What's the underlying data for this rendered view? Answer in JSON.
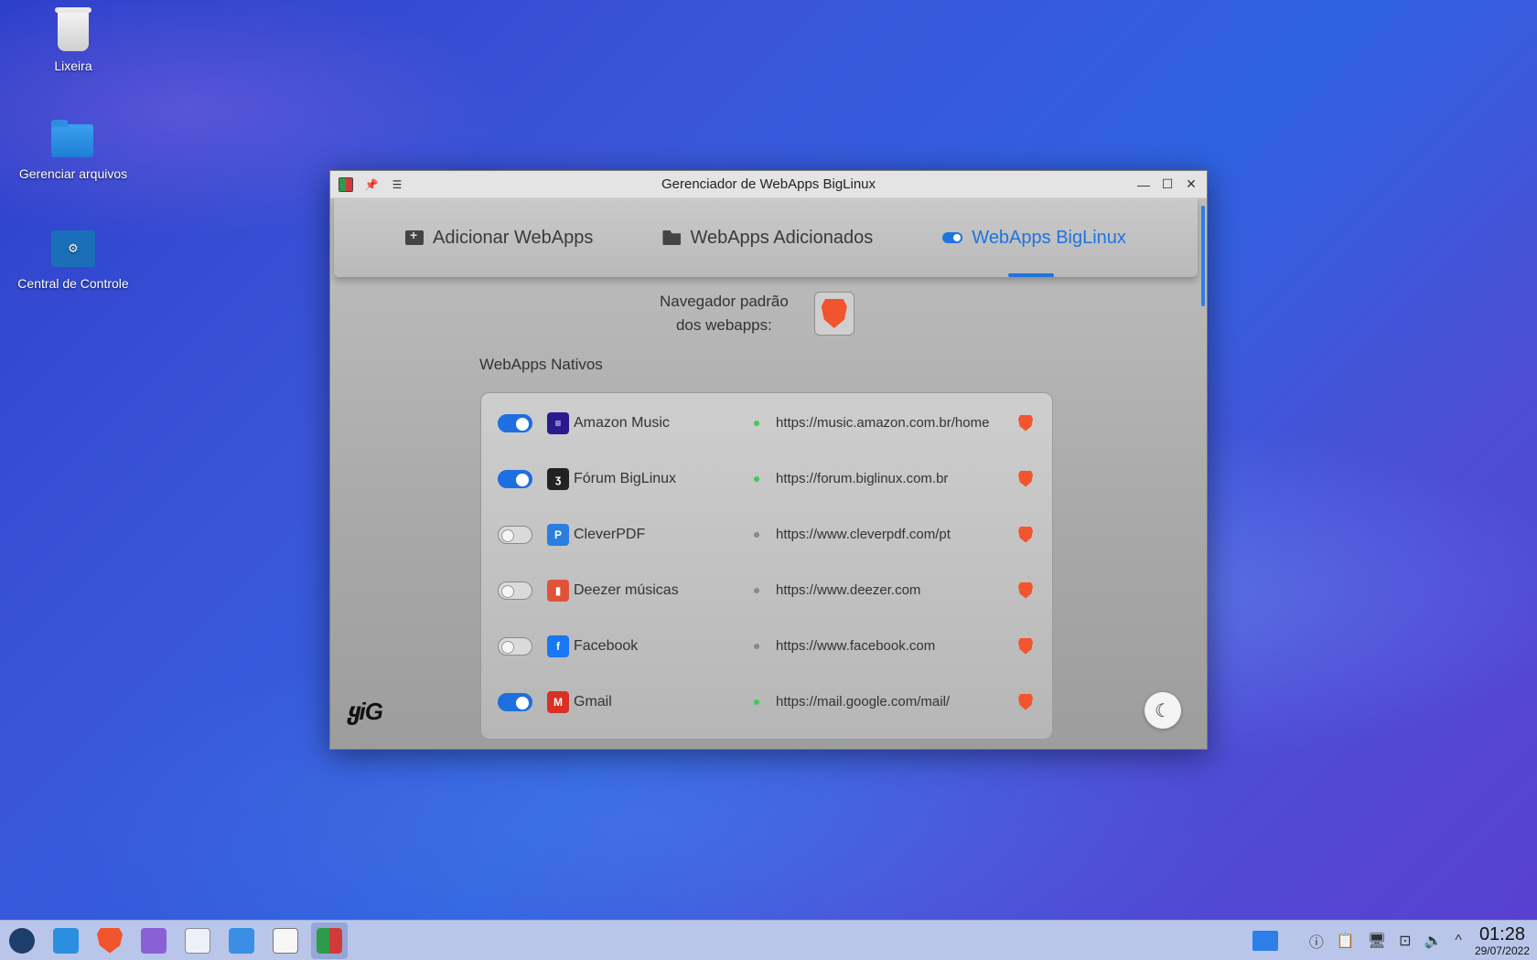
{
  "desktop": {
    "icons": [
      {
        "label": "Lixeira",
        "icon": "trash-icon"
      },
      {
        "label": "Gerenciar arquivos",
        "icon": "folder-icon"
      },
      {
        "label": "Central de Controle",
        "icon": "control-center-icon"
      }
    ]
  },
  "window": {
    "title": "Gerenciador de WebApps BigLinux",
    "tabs": [
      {
        "label": "Adicionar WebApps",
        "icon": "folder-plus-icon",
        "active": false
      },
      {
        "label": "WebApps Adicionados",
        "icon": "folder-open-icon",
        "active": false
      },
      {
        "label": "WebApps BigLinux",
        "icon": "toggle-icon",
        "active": true
      }
    ],
    "browser_label_line1": "Navegador padrão",
    "browser_label_line2": "dos webapps:",
    "section_title": "WebApps Nativos",
    "logo_text": "ყiG",
    "theme_icon": "moon-icon",
    "colors": {
      "accent": "#1e74e0",
      "status_on": "#3fc95a",
      "brave": "#f2542d"
    },
    "webapps": [
      {
        "name": "Amazon Music",
        "url": "https://music.amazon.com.br/home",
        "enabled": true,
        "icon_color": "#2a1a8e",
        "icon_text": "≡"
      },
      {
        "name": "Fórum BigLinux",
        "url": "https://forum.biglinux.com.br",
        "enabled": true,
        "icon_color": "#222222",
        "icon_text": "ʒ"
      },
      {
        "name": "CleverPDF",
        "url": "https://www.cleverpdf.com/pt",
        "enabled": false,
        "icon_color": "#2b7de0",
        "icon_text": "P"
      },
      {
        "name": "Deezer músicas",
        "url": "https://www.deezer.com",
        "enabled": false,
        "icon_color": "#e0533b",
        "icon_text": "▮"
      },
      {
        "name": "Facebook",
        "url": "https://www.facebook.com",
        "enabled": false,
        "icon_color": "#1877f2",
        "icon_text": "f"
      },
      {
        "name": "Gmail",
        "url": "https://mail.google.com/mail/",
        "enabled": true,
        "icon_color": "#d93025",
        "icon_text": "M"
      }
    ]
  },
  "taskbar": {
    "apps": [
      "biglinux-menu-icon",
      "file-manager-icon",
      "brave-icon",
      "calculator-icon",
      "documents-icon",
      "text-editor-icon",
      "notes-icon",
      "webapps-manager-icon"
    ],
    "time": "01:28",
    "date": "29/07/2022"
  }
}
